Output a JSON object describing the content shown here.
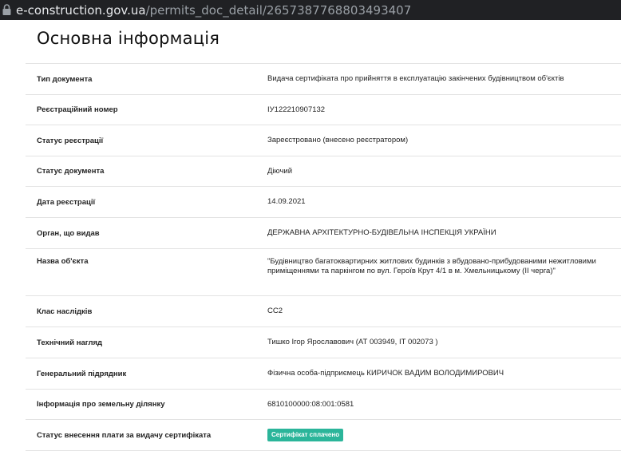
{
  "browser": {
    "url_host": "e-construction.gov.ua",
    "url_path": "/permits_doc_detail/2657387768803493407"
  },
  "page": {
    "title": "Основна інформація"
  },
  "rows": [
    {
      "label": "Тип документа",
      "value": "Видача сертифіката про прийняття в експлуатацію закінчених будівництвом об'єктів"
    },
    {
      "label": "Реєстраційний номер",
      "value": "ІУ122210907132"
    },
    {
      "label": "Статус реєстрації",
      "value": "Зареєстровано (внесено реєстратором)"
    },
    {
      "label": "Статус документа",
      "value": "Діючий"
    },
    {
      "label": "Дата реєстрації",
      "value": "14.09.2021"
    },
    {
      "label": "Орган, що видав",
      "value": "ДЕРЖАВНА АРХІТЕКТУРНО-БУДІВЕЛЬНА ІНСПЕКЦІЯ УКРАЇНИ"
    },
    {
      "label": "Назва об'єкта",
      "value": "\"Будівництво багатоквартирних житлових будинків з вбудовано-прибудованими нежитловими приміщеннями та паркінгом по вул. Героїв Крут 4/1 в м. Хмельницькому (ІІ черга)\""
    },
    {
      "label": "Клас наслідків",
      "value": "СС2"
    },
    {
      "label": "Технічний нагляд",
      "value": "Тишко Ігор Ярославович (АТ 003949, ІТ 002073 )"
    },
    {
      "label": "Генеральний підрядник",
      "value": "Фізична особа-підприємець КИРИЧОК ВАДИМ ВОЛОДИМИРОВИЧ"
    },
    {
      "label": "Інформація про земельну ділянку",
      "value": "6810100000:08:001:0581"
    },
    {
      "label": "Статус внесення плати за видачу сертифіката",
      "badge": "Сертифікат сплачено",
      "badge_color": "#2bb59a"
    }
  ]
}
